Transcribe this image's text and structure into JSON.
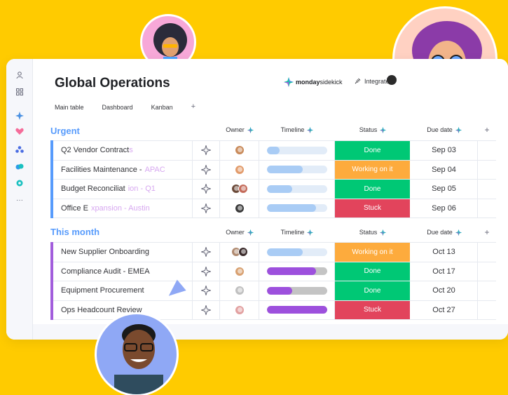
{
  "board": {
    "title": "Global Operations",
    "tabs": [
      "Main table",
      "Dashboard",
      "Kanban"
    ],
    "add_tab": "+"
  },
  "header": {
    "brand_bold": "monday",
    "brand_light": "sidekick",
    "integrate_label": "Integrate"
  },
  "columns": {
    "owner": "Owner",
    "timeline": "Timeline",
    "status": "Status",
    "due": "Due date",
    "add": "+"
  },
  "colors": {
    "done": "#00C875",
    "working": "#FDAB3D",
    "stuck": "#E2445C",
    "urgent": "#579BFC",
    "month": "#A25DDC",
    "timeline_blue": "#A9CCF5",
    "timeline_purple": "#9D50DD"
  },
  "groups": [
    {
      "title": "Urgent",
      "color": "#579BFC",
      "rows": [
        {
          "name": "Q2 Vendor Contract",
          "name_faded": "s",
          "status": "Done",
          "due": "Sep 03",
          "timeline_progress": 0.22
        },
        {
          "name": "Facilities Maintenance -",
          "name_faded": "APAC",
          "status": "Working on it",
          "due": "Sep 04",
          "timeline_progress": 0.6
        },
        {
          "name": "Budget Reconciliat",
          "name_faded": "ion - Q1",
          "status": "Done",
          "due": "Sep 05",
          "timeline_progress": 0.42
        },
        {
          "name": "Office E",
          "name_faded": "xpansion - Austin",
          "status": "Stuck",
          "due": "Sep 06",
          "timeline_progress": 0.82
        }
      ]
    },
    {
      "title": "This month",
      "color": "#A25DDC",
      "rows": [
        {
          "name": "New Supplier Onboarding",
          "name_faded": "",
          "status": "Working on it",
          "due": "Oct 13",
          "timeline_progress": 0.6
        },
        {
          "name": "Compliance Audit - EMEA",
          "name_faded": "",
          "status": "Done",
          "due": "Oct 17",
          "timeline_progress": 0.82
        },
        {
          "name": "Equipment Procurement",
          "name_faded": "",
          "status": "Done",
          "due": "Oct 20",
          "timeline_progress": 0.42
        },
        {
          "name": "Ops Headcount Review",
          "name_faded": "",
          "status": "Stuck",
          "due": "Oct 27",
          "timeline_progress": 1.0
        }
      ]
    }
  ]
}
